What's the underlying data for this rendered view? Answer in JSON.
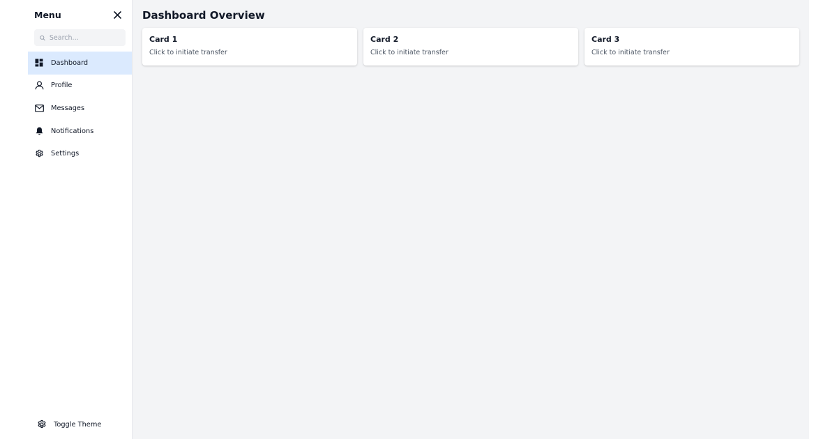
{
  "sidebar": {
    "title": "Menu",
    "search": {
      "placeholder": "Search...",
      "value": ""
    },
    "items": [
      {
        "label": "Dashboard",
        "icon": "dashboard-icon",
        "active": true
      },
      {
        "label": "Profile",
        "icon": "user-icon",
        "active": false
      },
      {
        "label": "Messages",
        "icon": "mail-icon",
        "active": false
      },
      {
        "label": "Notifications",
        "icon": "bell-icon",
        "active": false
      },
      {
        "label": "Settings",
        "icon": "gear-icon",
        "active": false
      }
    ],
    "theme_toggle_label": "Toggle Theme"
  },
  "main": {
    "title": "Dashboard Overview",
    "cards": [
      {
        "title": "Card 1",
        "text": "Click to initiate transfer"
      },
      {
        "title": "Card 2",
        "text": "Click to initiate transfer"
      },
      {
        "title": "Card 3",
        "text": "Click to initiate transfer"
      }
    ]
  },
  "colors": {
    "active_item_bg": "#dbeafe",
    "main_bg": "#f3f4f6",
    "card_bg": "#ffffff"
  }
}
